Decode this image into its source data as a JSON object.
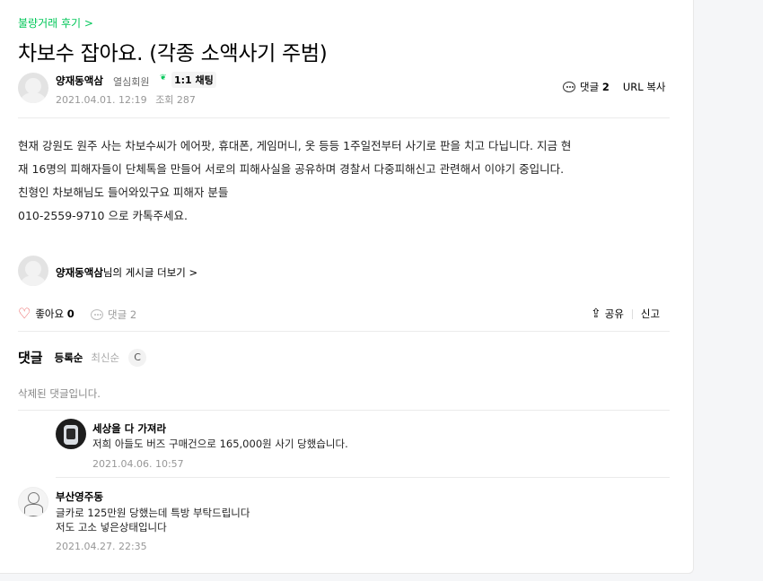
{
  "breadcrumb": "불량거래 후기 >",
  "title": "차보수 잡아요. (각종 소액사기 주범)",
  "author": {
    "name": "양재동액삼",
    "grade": "열심회원",
    "chat_label": "1:1 채팅",
    "date": "2021.04.01. 12:19",
    "views": "조회 287"
  },
  "top_actions": {
    "comments_label": "댓글",
    "comments_count": "2",
    "url_copy": "URL 복사"
  },
  "body_lines": [
    "현재 강원도 원주 사는 차보수씨가 에어팟, 휴대폰, 게임머니, 옷 등등 1주일전부터 사기로 판을 치고 다닙니다. 지금 현",
    "재 16명의 피해자들이 단체톡을 만들어 서로의 피해사실을 공유하며 경찰서 다중피해신고 관련해서 이야기 중입니다.",
    "친형인 차보해님도 들어와있구요 피해자 분들",
    "010-2559-9710 으로 카톡주세요."
  ],
  "more_posts": {
    "name": "양재동액삼",
    "suffix": "님의 게시글 더보기 >"
  },
  "bottom_actions": {
    "like_label": "좋아요",
    "like_count": "0",
    "comment_label": "댓글",
    "comment_count": "2",
    "share": "공유",
    "report": "신고"
  },
  "comments_header": {
    "title": "댓글",
    "sort_active": "등록순",
    "sort_inactive": "최신순",
    "refresh_icon": "C"
  },
  "comments": [
    {
      "text": "삭제된 댓글입니다."
    },
    {
      "name": "세상을 다 가져라",
      "text": "저희 아들도 버즈 구매건으로 165,000원 사기 당했습니다.",
      "date": "2021.04.06. 10:57"
    },
    {
      "name": "부산영주동",
      "text1": "글카로 125만원 당했는데 특방 부탁드립니다",
      "text2": "저도 고소 넣은상태입니다",
      "date": "2021.04.27. 22:35"
    }
  ],
  "colors": {
    "accent": "#03c75a",
    "heart": "#e84b4b"
  }
}
